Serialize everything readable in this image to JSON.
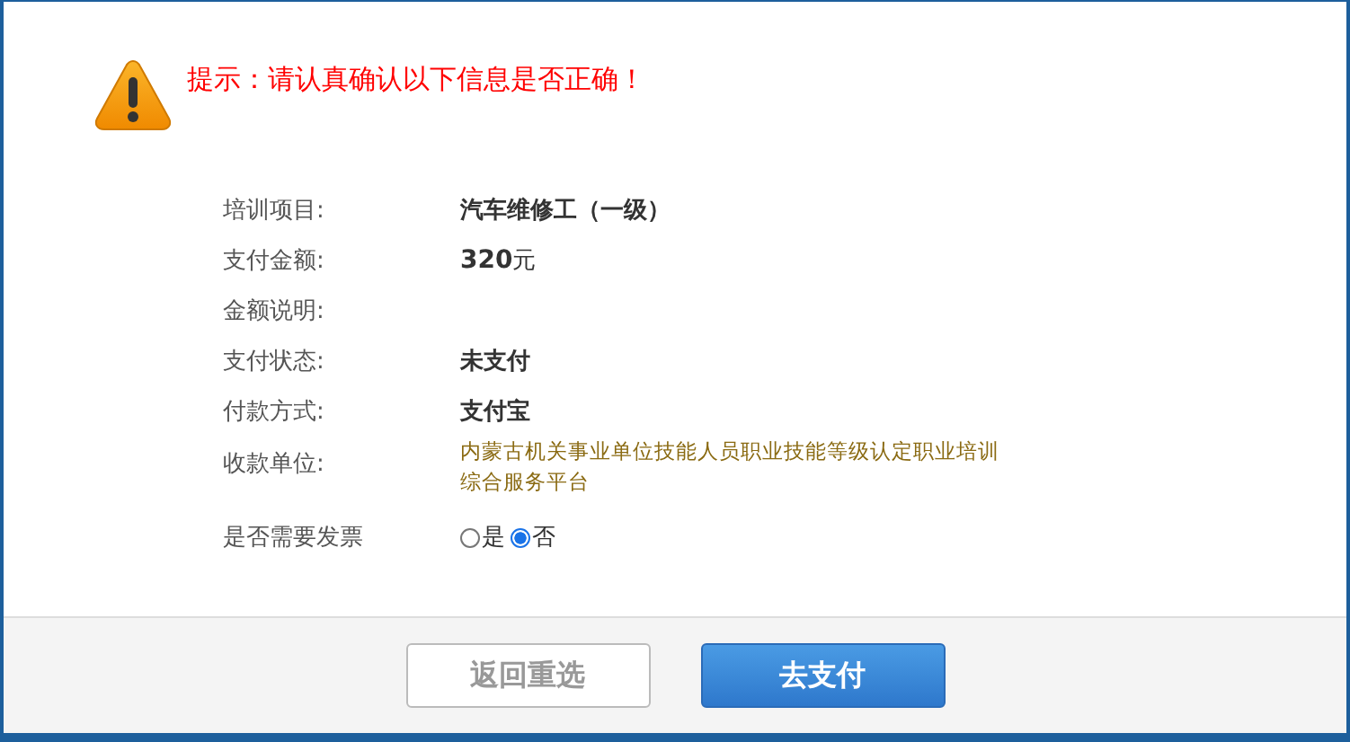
{
  "alert": {
    "text": "提示：请认真确认以下信息是否正确！"
  },
  "fields": [
    {
      "label": "培训项目:",
      "kind": "bold",
      "value": "汽车维修工（一级）"
    },
    {
      "label": "支付金额:",
      "kind": "amount",
      "value": "320",
      "unit": "元"
    },
    {
      "label": "金额说明:",
      "kind": "bold"
    },
    {
      "label": "支付状态:",
      "kind": "bold",
      "value": "未支付"
    },
    {
      "label": "付款方式:",
      "kind": "bold",
      "value": "支付宝"
    },
    {
      "label": "收款单位:",
      "kind": "note",
      "value": "内蒙古机关事业单位技能人员职业技能等级认定职业培训综合服务平台"
    },
    {
      "label": "是否需要发票",
      "kind": "radio",
      "options": [
        {
          "label": "是",
          "selected": false
        },
        {
          "label": "否",
          "selected": true
        }
      ]
    }
  ],
  "buttons": [
    {
      "label": "返回重选",
      "kind": "secondary"
    },
    {
      "label": "去支付",
      "kind": "primary"
    }
  ]
}
